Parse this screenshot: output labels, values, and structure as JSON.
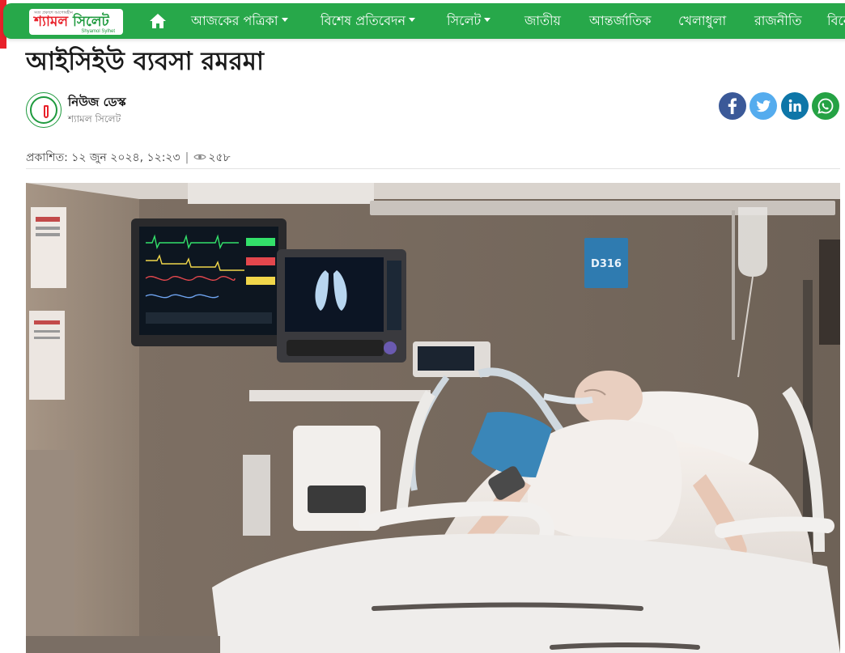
{
  "site": {
    "logo_tagline": "সত্য প্রকাশে আপোষহীন",
    "logo_part1": "শ্যামল ",
    "logo_part2": "সিলেট",
    "logo_sub": "Shyamol Sylhet"
  },
  "nav": {
    "items": [
      {
        "label": "আজকের পত্রিকা",
        "dropdown": true
      },
      {
        "label": "বিশেষ প্রতিবেদন",
        "dropdown": true
      },
      {
        "label": "সিলেট",
        "dropdown": true
      },
      {
        "label": "জাতীয়",
        "dropdown": false
      },
      {
        "label": "আন্তর্জাতিক",
        "dropdown": false
      },
      {
        "label": "খেলাধুলা",
        "dropdown": false
      },
      {
        "label": "রাজনীতি",
        "dropdown": false
      },
      {
        "label": "বিনো",
        "dropdown": false
      }
    ]
  },
  "article": {
    "title": "আইসিইউ ব্যবসা রমরমা",
    "author_name": "নিউজ ডেস্ক",
    "author_org": "শ্যামল সিলেট",
    "published_label": "প্রকাশিত: ১২ জুন ২০২৪, ১২:২৩",
    "separator": "|",
    "views": "২৫৮",
    "image_room_label": "D316"
  },
  "share": [
    "facebook",
    "twitter",
    "linkedin",
    "whatsapp"
  ],
  "icons": {
    "home": "home-icon",
    "eye": "eye-icon"
  },
  "colors": {
    "nav_green": "#27a84a",
    "brand_red": "#e8212a",
    "facebook": "#3b5998",
    "twitter": "#55acee",
    "linkedin": "#0e76a8",
    "whatsapp": "#25a244"
  }
}
